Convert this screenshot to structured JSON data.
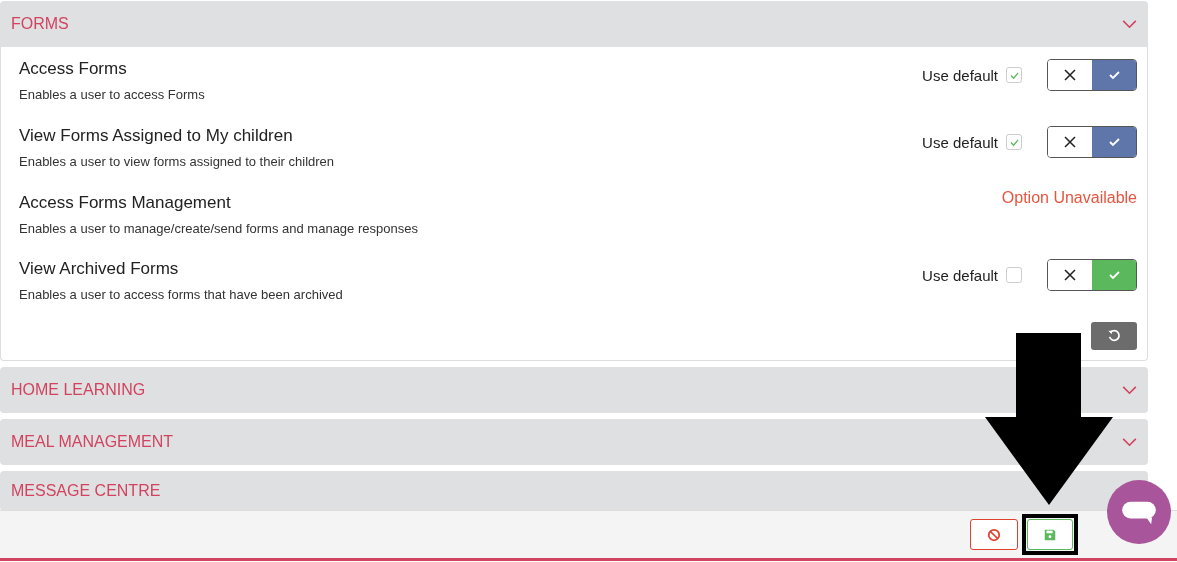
{
  "sections": [
    {
      "title": "FORMS",
      "expanded": true,
      "permissions": [
        {
          "kind": "toggle",
          "title": "Access Forms",
          "description": "Enables a user to access Forms",
          "default_label": "Use default",
          "use_default": true,
          "enabled": true
        },
        {
          "kind": "toggle",
          "title": "View Forms Assigned to My children",
          "description": "Enables a user to view forms assigned to their children",
          "default_label": "Use default",
          "use_default": true,
          "enabled": true
        },
        {
          "kind": "unavailable",
          "title": "Access Forms Management",
          "description": "Enables a user to manage/create/send forms and manage responses",
          "status": "Option Unavailable"
        },
        {
          "kind": "toggle",
          "title": "View Archived Forms",
          "description": "Enables a user to access forms that have been archived",
          "default_label": "Use default",
          "use_default": false,
          "enabled": true
        }
      ]
    },
    {
      "title": "HOME LEARNING",
      "expanded": false
    },
    {
      "title": "MEAL MANAGEMENT",
      "expanded": false
    },
    {
      "title": "MESSAGE CENTRE",
      "expanded": false
    }
  ]
}
